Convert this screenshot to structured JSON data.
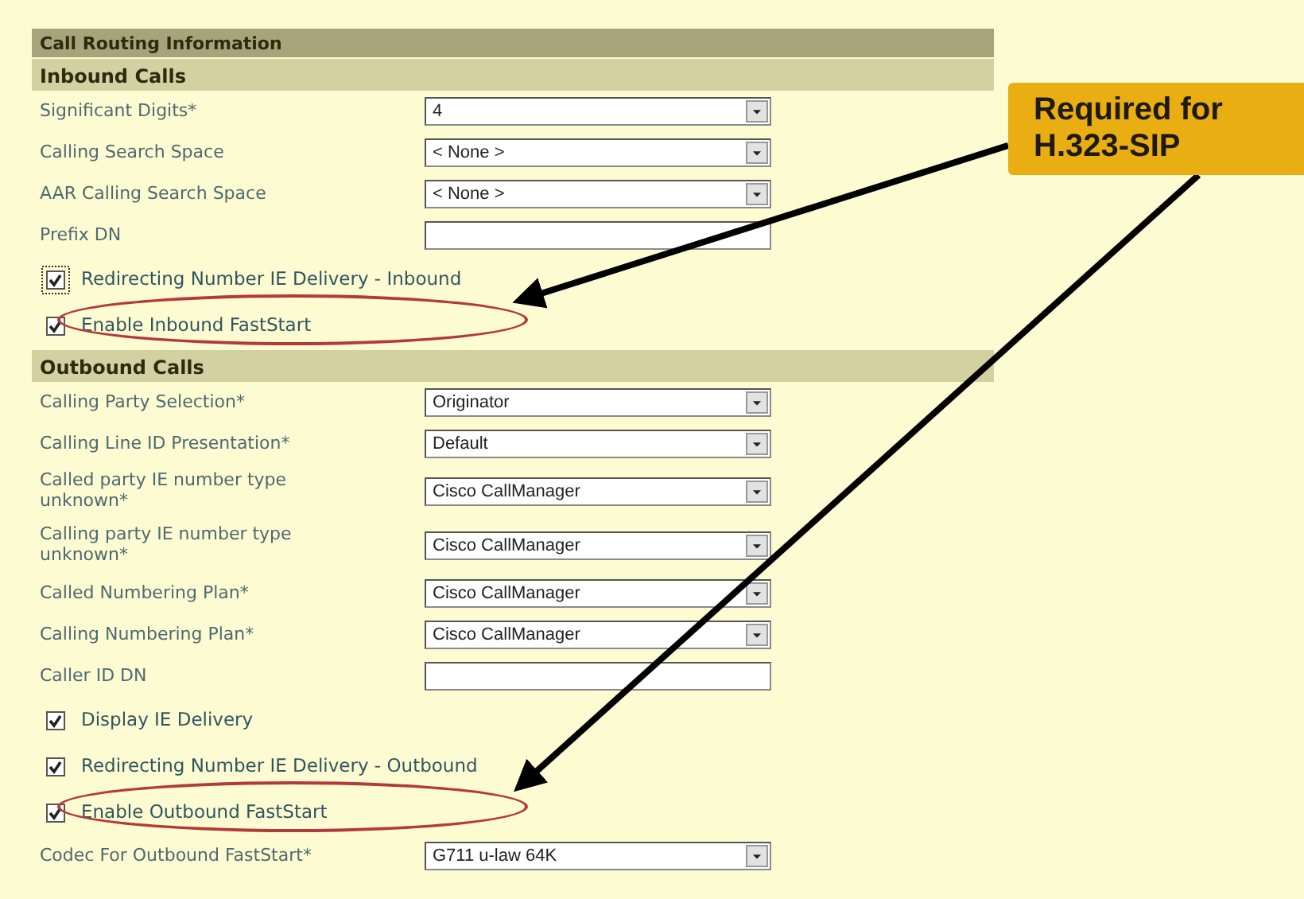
{
  "section_title": "Call Routing Information",
  "groups": [
    {
      "title": "Inbound Calls",
      "rows": [
        {
          "kind": "select",
          "label": "Significant Digits*",
          "value": "4"
        },
        {
          "kind": "select",
          "label": "Calling Search Space",
          "value": "< None >"
        },
        {
          "kind": "select",
          "label": "AAR Calling Search Space",
          "value": "< None >"
        },
        {
          "kind": "text",
          "label": "Prefix DN"
        },
        {
          "kind": "checkbox",
          "label": "Redirecting Number IE Delivery - Inbound",
          "checked": true,
          "focused": true,
          "circled": false
        },
        {
          "kind": "checkbox",
          "label": "Enable Inbound FastStart",
          "checked": true,
          "focused": false,
          "circled": true
        }
      ]
    },
    {
      "title": "Outbound Calls",
      "rows": [
        {
          "kind": "select",
          "label": "Calling Party Selection*",
          "value": "Originator"
        },
        {
          "kind": "select",
          "label": "Calling Line ID Presentation*",
          "value": "Default"
        },
        {
          "kind": "select",
          "label": "Called party IE number type unknown*",
          "value": "Cisco CallManager"
        },
        {
          "kind": "select",
          "label": "Calling party IE number type unknown*",
          "value": "Cisco CallManager"
        },
        {
          "kind": "select",
          "label": "Called Numbering Plan*",
          "value": "Cisco CallManager"
        },
        {
          "kind": "select",
          "label": "Calling Numbering Plan*",
          "value": "Cisco CallManager"
        },
        {
          "kind": "text",
          "label": "Caller ID DN"
        },
        {
          "kind": "checkbox",
          "label": "Display IE Delivery",
          "checked": true,
          "focused": false,
          "circled": false
        },
        {
          "kind": "checkbox",
          "label": "Redirecting Number IE Delivery - Outbound",
          "checked": true,
          "focused": false,
          "circled": false
        },
        {
          "kind": "checkbox",
          "label": "Enable Outbound FastStart",
          "checked": true,
          "focused": false,
          "circled": true
        },
        {
          "kind": "select",
          "label": "Codec For Outbound FastStart*",
          "value": "G711 u-law 64K"
        }
      ]
    }
  ],
  "callout": "Required for H.323-SIP"
}
